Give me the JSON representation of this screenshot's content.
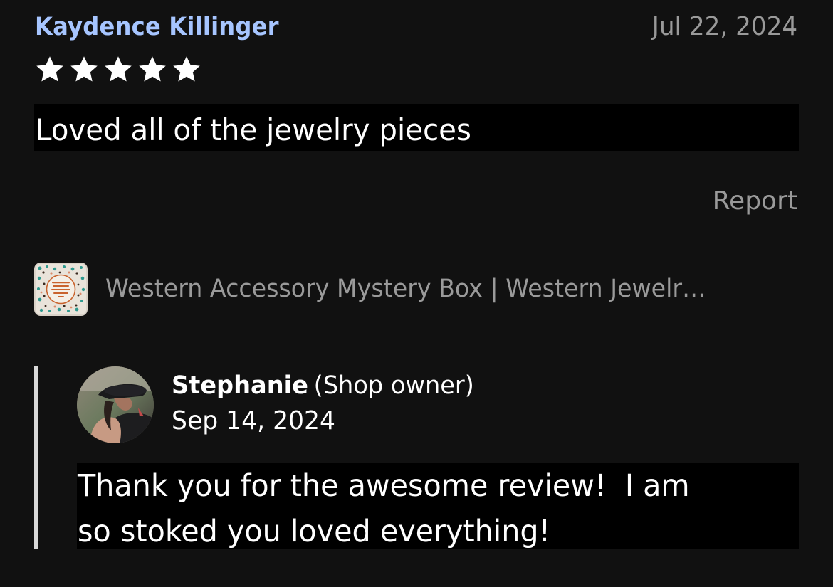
{
  "review": {
    "reviewer_name": "Kaydence Killinger",
    "date": "Jul 22, 2024",
    "rating": 5,
    "rating_max": 5,
    "text": "Loved all of the jewelry pieces",
    "report_label": "Report"
  },
  "listing": {
    "thumbnail_icon": "listing-thumbnail",
    "title": "Western Accessory Mystery Box | Western Jewelr…"
  },
  "reply": {
    "owner_name": "Stephanie",
    "owner_role": "(Shop owner)",
    "date": "Sep 14, 2024",
    "text": "Thank you for the awesome review!  I am\nso stoked you loved everything!"
  },
  "colors": {
    "background": "#111111",
    "reviewer_name": "#a6c5ff",
    "muted_text": "#9a9a9a",
    "highlight_box": "#000000",
    "reply_bar": "#d9d9d9"
  }
}
